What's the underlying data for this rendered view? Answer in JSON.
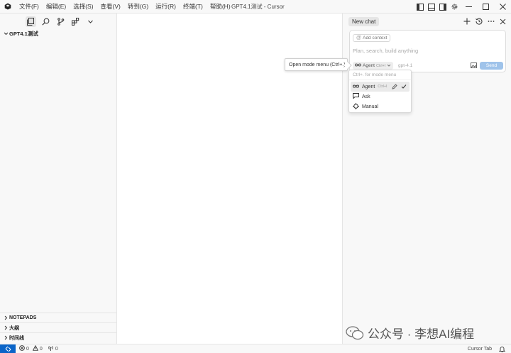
{
  "menu": [
    "文件(F)",
    "编辑(E)",
    "选择(S)",
    "查看(V)",
    "转到(G)",
    "运行(R)",
    "终端(T)",
    "帮助(H)"
  ],
  "window_title": "GPT4.1测试 - Cursor",
  "sidebar": {
    "folder": "GPT4.1测试",
    "sections": [
      "NOTEPADS",
      "大纲",
      "时间线"
    ]
  },
  "chat": {
    "tab_label": "New chat",
    "composer": {
      "add_context": "Add context",
      "placeholder": "Plan, search, build anything",
      "mode": "Agent",
      "mode_shortcut": "Ctrl+I",
      "model": "gpt-4.1",
      "send": "Send"
    }
  },
  "tooltip": "Open mode menu (Ctrl+.)",
  "mode_menu": {
    "hint": "Ctrl+. for mode menu",
    "items": [
      {
        "label": "Agent",
        "shortcut": "Ctrl+I"
      },
      {
        "label": "Ask"
      },
      {
        "label": "Manual"
      }
    ]
  },
  "watermark": "公众号 · 李想AI编程",
  "status": {
    "errors": "0",
    "warnings": "0",
    "ports": "0",
    "cursor_tab": "Cursor Tab"
  }
}
